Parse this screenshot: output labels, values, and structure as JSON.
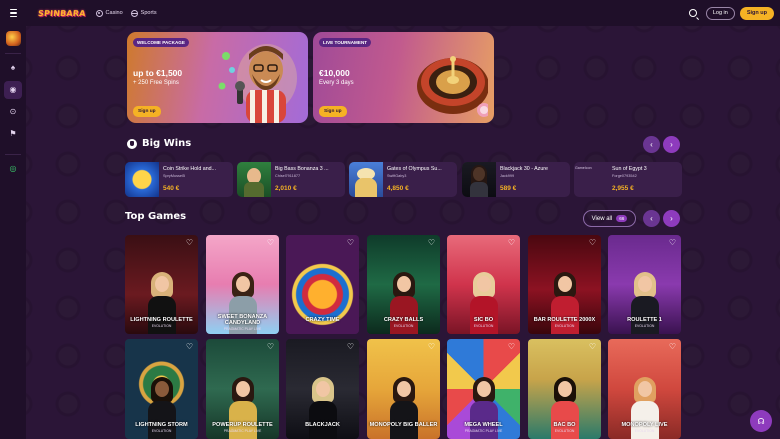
{
  "header": {
    "logo": "SPINBARA",
    "nav": [
      {
        "label": "Casino",
        "icon": "casino-icon"
      },
      {
        "label": "Sports",
        "icon": "sports-icon"
      }
    ],
    "login_label": "Log in",
    "signup_label": "Sign up"
  },
  "sidebar": {
    "items": [
      {
        "icon": "promotions-icon"
      },
      {
        "icon": "casino-icon"
      },
      {
        "icon": "live-casino-icon"
      },
      {
        "icon": "sports-icon"
      },
      {
        "icon": "live-sports-icon"
      },
      {
        "icon": "casino-chip-icon"
      }
    ]
  },
  "banners": [
    {
      "tag": "WELCOME PACKAGE",
      "headline": "up to €1,500",
      "subline": "+ 250 Free Spins",
      "button": "Sign up"
    },
    {
      "tag": "LIVE TOURNAMENT",
      "headline": "€10,000",
      "subline": "Every 3 days",
      "button": "Sign up"
    }
  ],
  "big_wins": {
    "title": "Big Wins",
    "items": [
      {
        "game": "Coin Strike Hold and...",
        "user": "SpryMussel5",
        "amount": "540 €"
      },
      {
        "game": "Big Bass Bonanza 3 ...",
        "user": "Chisel7911877",
        "amount": "2,010 €"
      },
      {
        "game": "Gates of Olympus Su...",
        "user": "SwiftGaby3",
        "amount": "4,850 €"
      },
      {
        "game": "Blackjack 30 - Azure",
        "user": "Jack999",
        "amount": "589 €"
      },
      {
        "game": "Sun of Egypt 3",
        "user": "Forge0793542",
        "amount": "2,955 €",
        "thumb_alt": "GameIcon"
      }
    ]
  },
  "top_games": {
    "title": "Top Games",
    "view_all": "View all",
    "count": "66",
    "games": [
      {
        "title": "LIGHTNING ROULETTE",
        "provider": "EVOLUTION"
      },
      {
        "title": "SWEET BONANZA CANDYLAND",
        "provider": "PRAGMATIC PLAY LIVE"
      },
      {
        "title": "CRAZY TIME",
        "provider": ""
      },
      {
        "title": "CRAZY BALLS",
        "provider": "EVOLUTION"
      },
      {
        "title": "SIC BO",
        "provider": "EVOLUTION"
      },
      {
        "title": "BAR ROULETTE 2000X",
        "provider": "EVOLUTION"
      },
      {
        "title": "ROULETTE 1",
        "provider": "EVOLUTION"
      },
      {
        "title": "LIGHTNING STORM",
        "provider": "EVOLUTION"
      },
      {
        "title": "POWERUP ROULETTE",
        "provider": "PRAGMATIC PLAY LIVE"
      },
      {
        "title": "BLACKJACK",
        "provider": ""
      },
      {
        "title": "MONOPOLY BIG BALLER",
        "provider": ""
      },
      {
        "title": "MEGA WHEEL",
        "provider": "PRAGMATIC PLAY LIVE"
      },
      {
        "title": "BAC BO",
        "provider": "EVOLUTION"
      },
      {
        "title": "MONOPOLY LIVE",
        "provider": "EVOLUTION"
      }
    ]
  },
  "colors": {
    "accent": "#f5b224",
    "purple": "#8e3bbd",
    "background": "#2b1537"
  }
}
